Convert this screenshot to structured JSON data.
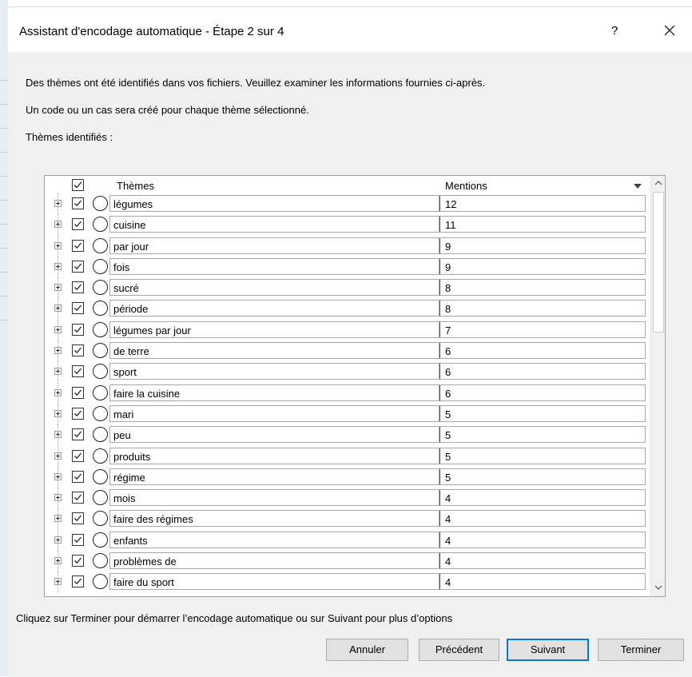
{
  "dialog": {
    "title": "Assistant d'encodage automatique - Étape 2 sur 4",
    "help_label": "?",
    "intro_line1": "Des thèmes ont été identifiés dans vos fichiers. Veuillez examiner les informations fournies ci-après.",
    "intro_line2": "Un code ou un cas sera créé pour chaque thème sélectionné.",
    "identified_label": "Thèmes identifiés :"
  },
  "grid": {
    "col_themes": "Thèmes",
    "col_mentions": "Mentions",
    "rows": [
      {
        "theme": "légumes",
        "mentions": "12",
        "checked": true
      },
      {
        "theme": "cuisine",
        "mentions": "11",
        "checked": true
      },
      {
        "theme": "par jour",
        "mentions": "9",
        "checked": true
      },
      {
        "theme": "fois",
        "mentions": "9",
        "checked": true
      },
      {
        "theme": "sucré",
        "mentions": "8",
        "checked": true
      },
      {
        "theme": "période",
        "mentions": "8",
        "checked": true
      },
      {
        "theme": "légumes par jour",
        "mentions": "7",
        "checked": true
      },
      {
        "theme": "de terre",
        "mentions": "6",
        "checked": true
      },
      {
        "theme": "sport",
        "mentions": "6",
        "checked": true
      },
      {
        "theme": "faire la cuisine",
        "mentions": "6",
        "checked": true
      },
      {
        "theme": "mari",
        "mentions": "5",
        "checked": true
      },
      {
        "theme": "peu",
        "mentions": "5",
        "checked": true
      },
      {
        "theme": "produits",
        "mentions": "5",
        "checked": true
      },
      {
        "theme": "régime",
        "mentions": "5",
        "checked": true
      },
      {
        "theme": "mois",
        "mentions": "4",
        "checked": true
      },
      {
        "theme": "faire des régimes",
        "mentions": "4",
        "checked": true
      },
      {
        "theme": "enfants",
        "mentions": "4",
        "checked": true
      },
      {
        "theme": "problèmes de",
        "mentions": "4",
        "checked": true
      },
      {
        "theme": "faire du sport",
        "mentions": "4",
        "checked": true
      }
    ]
  },
  "footer": {
    "hint": "Cliquez sur Terminer pour démarrer l’encodage automatique ou sur Suivant pour plus d’options",
    "cancel_label": "Annuler",
    "previous_label": "Précédent",
    "next_label": "Suivant",
    "finish_label": "Terminer"
  },
  "colors": {
    "default_button_border": "#0078d7",
    "dialog_bg": "#f0f0f0"
  }
}
